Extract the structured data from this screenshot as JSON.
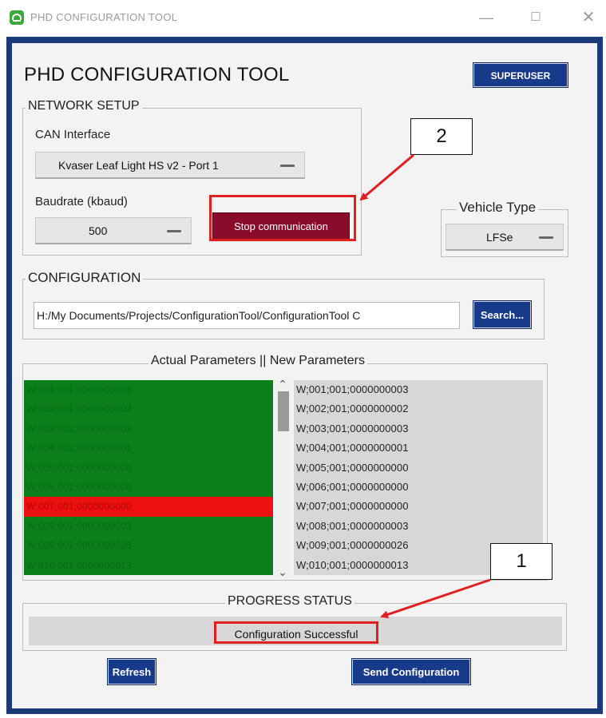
{
  "window": {
    "title": "PHD CONFIGURATION TOOL",
    "minimize_glyph": "—",
    "maximize_glyph": "☐",
    "close_glyph": "✕",
    "frame_color": "#1a3a7a"
  },
  "header": {
    "title": "PHD CONFIGURATION TOOL",
    "superuser_label": "SUPERUSER"
  },
  "network_setup": {
    "legend": "NETWORK SETUP",
    "can_label": "CAN Interface",
    "can_value": "Kvaser Leaf Light HS v2 - Port 1",
    "baud_label": "Baudrate (kbaud)",
    "baud_value": "500",
    "stop_label": "Stop communication",
    "stop_color": "#8b0b2a"
  },
  "vehicle": {
    "legend": "Vehicle Type",
    "value": "LFSe"
  },
  "configuration": {
    "legend": "CONFIGURATION",
    "path": "H:/My Documents/Projects/ConfigurationTool/ConfigurationTool C",
    "search_label": "Search..."
  },
  "parameters": {
    "legend": "Actual Parameters || New Parameters",
    "actual": [
      "W;001;001;0000000003",
      "W;002;001;0000000002",
      "W;003;001;0000000003",
      "W;004;001;0000000001",
      "W;005;001;0000000000",
      "W;006;001;0000000000",
      "W;007;001;0000000000",
      "W;008;001;0000000003",
      "W;009;001;0000000026",
      "W;010;001;0000000013"
    ],
    "actual_status": [
      "ok",
      "ok",
      "ok",
      "ok",
      "ok",
      "ok",
      "mismatch",
      "ok",
      "ok",
      "ok"
    ],
    "new": [
      "W;001;001;0000000003",
      "W;002;001;0000000002",
      "W;003;001;0000000003",
      "W;004;001;0000000001",
      "W;005;001;0000000000",
      "W;006;001;0000000000",
      "W;007;001;0000000000",
      "W;008;001;0000000003",
      "W;009;001;0000000026",
      "W;010;001;0000000013"
    ],
    "ok_color": "#0a7f1a",
    "mismatch_color": "#ee1010"
  },
  "progress": {
    "legend": "PROGRESS STATUS",
    "status_text": "Configuration Successful"
  },
  "footer": {
    "refresh_label": "Refresh",
    "send_label": "Send Configuration"
  },
  "annotations": {
    "callout_1": "1",
    "callout_2": "2",
    "highlight_color": "#e02020"
  }
}
